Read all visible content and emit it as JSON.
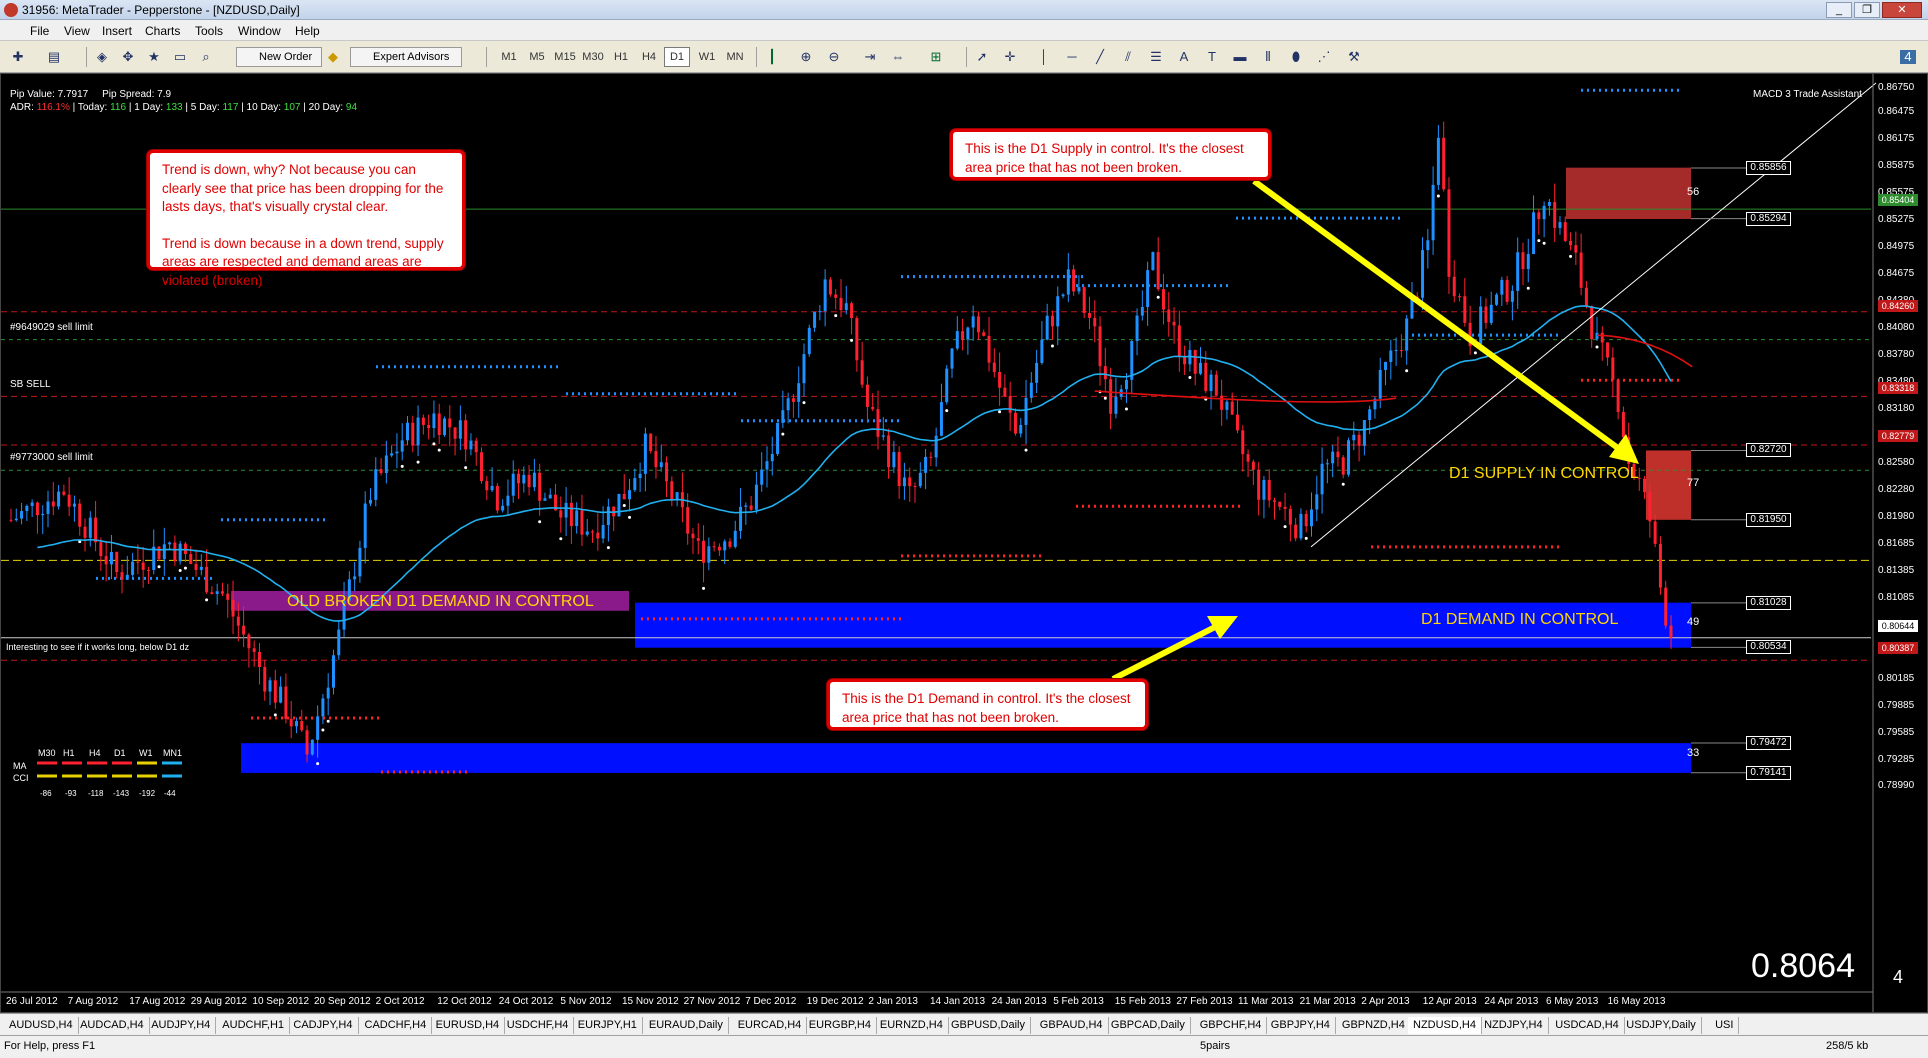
{
  "window": {
    "title": "31956: MetaTrader - Pepperstone - [NZDUSD,Daily]",
    "controls": [
      "_",
      "❐",
      "✕"
    ]
  },
  "menu": [
    "File",
    "View",
    "Insert",
    "Charts",
    "Tools",
    "Window",
    "Help"
  ],
  "toolbar": {
    "new_order": "New Order",
    "expert_advisors": "Expert Advisors",
    "timeframes": [
      "M1",
      "M5",
      "M15",
      "M30",
      "H1",
      "H4",
      "D1",
      "W1",
      "MN"
    ],
    "active_timeframe": "D1",
    "tool_letters": [
      "A",
      "T"
    ]
  },
  "chart": {
    "symbol": "NZDUSD",
    "period": "Daily",
    "info_line1": {
      "pip_value": "Pip Value: 7.7917",
      "pip_spread": "Pip Spread: 7.9"
    },
    "info_line2": {
      "adr_label": "ADR:",
      "adr_val": "116.1%",
      "today_label": "Today:",
      "today_val": "116",
      "day1_label": "1 Day:",
      "day1_val": "133",
      "day5_label": "5 Day:",
      "day5_val": "117",
      "day10_label": "10 Day:",
      "day10_val": "107",
      "day20_label": "20 Day:",
      "day20_val": "94"
    },
    "indicator_name": "MACD 3 Trade Assistant",
    "left_labels": {
      "sell_limit_1": "#9649029 sell limit",
      "sb_sell": "SB SELL",
      "sell_limit_2": "#9773000 sell limit",
      "note": "Interesting to see if it works long, below D1 dz"
    },
    "mtf_panel": {
      "timeframes": [
        "M30",
        "H1",
        "H4",
        "D1",
        "W1",
        "MN1"
      ],
      "rows": [
        "MA",
        "CCI"
      ],
      "values": [
        "-86",
        "-93",
        "-118",
        "-143",
        "-192",
        "-44"
      ]
    },
    "callouts": {
      "trend": [
        "Trend is down, why? Not because you can clearly see that price has been dropping for the lasts days, that's visually crystal clear.",
        "Trend is down because in a down trend, supply areas are respected and demand areas are violated (broken)"
      ],
      "supply": "This is the D1 Supply in control. It's the closest area price that has not been broken.",
      "demand": "This is the D1 Demand in control. It's the closest area price that has not been broken."
    },
    "zones": {
      "old_demand": "OLD BROKEN D1 DEMAND IN CONTROL",
      "supply_control": "D1 SUPPLY IN CONTROL",
      "demand_control": "D1 DEMAND IN CONTROL",
      "supply_top_num": "56",
      "supply_mid_num": "77",
      "demand_num": "49",
      "demand_low_num": "33"
    },
    "level_labels": [
      "0.85856",
      "0.85294",
      "0.82720",
      "0.81950",
      "0.81028",
      "0.80534",
      "0.79472",
      "0.79141"
    ],
    "price_scale": [
      "0.86750",
      "0.86475",
      "0.86175",
      "0.85875",
      "0.85575",
      "0.85275",
      "0.84975",
      "0.84675",
      "0.84380",
      "0.84080",
      "0.83780",
      "0.83480",
      "0.83180",
      "0.82880",
      "0.82580",
      "0.82280",
      "0.81980",
      "0.81685",
      "0.81385",
      "0.81085",
      "0.80785",
      "0.80485",
      "0.80185",
      "0.79885",
      "0.79585",
      "0.79285",
      "0.78990"
    ],
    "price_tags": {
      "green": "0.85404",
      "red1": "0.84260",
      "red2": "0.83318",
      "red3": "0.82779",
      "white": "0.80644",
      "red4": "0.80387"
    },
    "bid": {
      "main": "0.8064",
      "small": "4"
    },
    "dates": [
      "26 Jul 2012",
      "7 Aug 2012",
      "17 Aug 2012",
      "29 Aug 2012",
      "10 Sep 2012",
      "20 Sep 2012",
      "2 Oct 2012",
      "12 Oct 2012",
      "24 Oct 2012",
      "5 Nov 2012",
      "15 Nov 2012",
      "27 Nov 2012",
      "7 Dec 2012",
      "19 Dec 2012",
      "2 Jan 2013",
      "14 Jan 2013",
      "24 Jan 2013",
      "5 Feb 2013",
      "15 Feb 2013",
      "27 Feb 2013",
      "11 Mar 2013",
      "21 Mar 2013",
      "2 Apr 2013",
      "12 Apr 2013",
      "24 Apr 2013",
      "6 May 2013",
      "16 May 2013"
    ]
  },
  "chart_data": {
    "type": "candlestick",
    "symbol": "NZDUSD",
    "timeframe": "Daily",
    "ylim": [
      0.7885,
      0.869
    ],
    "levels": [
      0.85856,
      0.85294,
      0.8272,
      0.8195,
      0.81028,
      0.80534,
      0.79472,
      0.79141
    ],
    "last_price": 0.80644
  },
  "tabs": [
    "AUDUSD,H4",
    "AUDCAD,H4",
    "AUDJPY,H4",
    "AUDCHF,H1",
    "CADJPY,H4",
    "CADCHF,H4",
    "EURUSD,H4",
    "USDCHF,H4",
    "EURJPY,H1",
    "EURAUD,Daily",
    "EURCAD,H4",
    "EURGBP,H4",
    "EURNZD,H4",
    "GBPUSD,Daily",
    "GBPAUD,H4",
    "GBPCAD,Daily",
    "GBPCHF,H4",
    "GBPJPY,H4",
    "GBPNZD,H4",
    "NZDUSD,H4",
    "NZDJPY,H4",
    "USDCAD,H4",
    "USDJPY,Daily",
    "USI"
  ],
  "status": {
    "help": "For Help, press F1",
    "profile": "5pairs",
    "traffic": "258/5 kb"
  }
}
